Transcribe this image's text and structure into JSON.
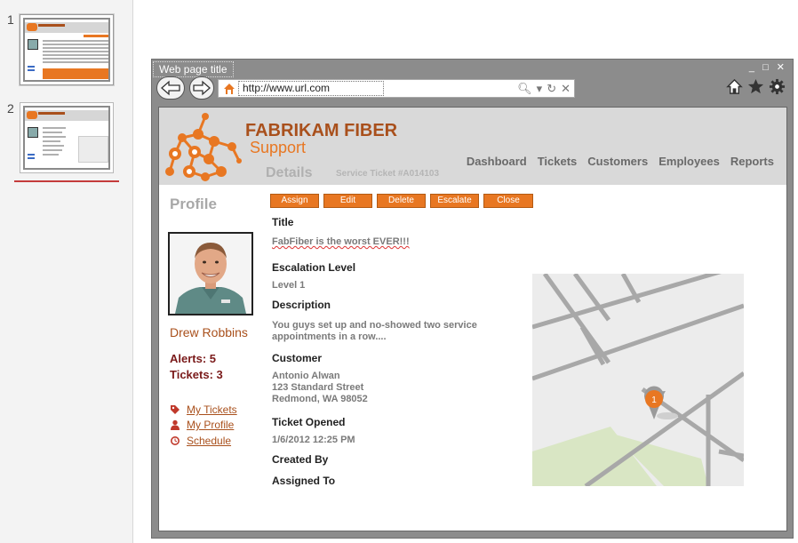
{
  "slides": [
    {
      "number": "1"
    },
    {
      "number": "2"
    }
  ],
  "browser": {
    "window_title": "Web page title",
    "window_controls": "_ □ ✕",
    "url": "http://www.url.com"
  },
  "site": {
    "brand_name": "FABRIKAM FIBER",
    "brand_sub": "Support",
    "page_heading": "Details",
    "ticket_label": "Service Ticket #A014103",
    "nav": [
      "Dashboard",
      "Tickets",
      "Customers",
      "Employees",
      "Reports"
    ],
    "accent_color": "#e87722",
    "brand_color": "#a9501c"
  },
  "profile": {
    "heading": "Profile",
    "name": "Drew Robbins",
    "alerts": "Alerts: 5",
    "tickets": "Tickets: 3",
    "links": [
      {
        "label": "My Tickets",
        "icon": "tag-icon"
      },
      {
        "label": "My Profile",
        "icon": "person-icon"
      },
      {
        "label": "Schedule",
        "icon": "clock-icon"
      }
    ]
  },
  "actions": [
    "Assign",
    "Edit",
    "Delete",
    "Escalate",
    "Close"
  ],
  "ticket": {
    "title_label": "Title",
    "title_value": "FabFiber is the worst EVER!!!",
    "escalation_label": "Escalation Level",
    "escalation_value": "Level 1",
    "description_label": "Description",
    "description_line1": "You guys set up and no-showed two service",
    "description_line2": "appointments in a row....",
    "customer_label": "Customer",
    "customer_name": "Antonio Alwan",
    "customer_street": "123 Standard Street",
    "customer_city": "Redmond, WA 98052",
    "opened_label": "Ticket Opened",
    "opened_value": "1/6/2012 12:25 PM",
    "created_by_label": "Created By",
    "assigned_to_label": "Assigned To"
  },
  "map": {
    "pin_label": "1"
  }
}
